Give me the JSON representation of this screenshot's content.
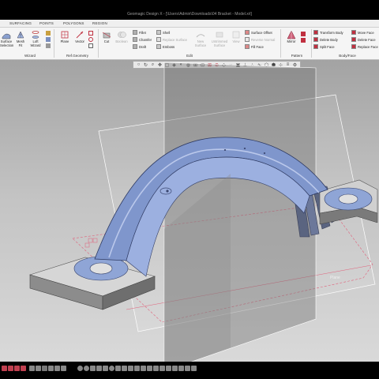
{
  "window": {
    "title": "Geomagic Design X - [\\Users\\Admin\\Downloads\\04 Bracket - Model.xrl]"
  },
  "tabs": [
    "SURFACING",
    "POINTS",
    "POLYGONS",
    "REGION"
  ],
  "ribbon": {
    "groups": {
      "wizard": "Wizard",
      "ref_geometry": "Ref.Geometry",
      "edit": "Edit",
      "pattern": "Pattern",
      "body_face": "Body/Face"
    },
    "wizard_tools": {
      "surface_partial": "Surface",
      "surface_partial2": "Selection",
      "mesh_fit": "Mesh\nFit",
      "loft_wizard": "Loft\nWizard"
    },
    "ref_tools": {
      "plane": "Plane",
      "vector": "Vector"
    },
    "edit_tools": {
      "cut": "Cut",
      "boolean": "Boolean",
      "fillet": "Fillet",
      "chamfer": "Chamfer",
      "draft": "Draft",
      "shell": "Shell",
      "emboss": "Emboss",
      "replace_surface": "Replace Surface",
      "new_surface": "New\nSurface",
      "untrimmed": "Untrimmed\nSurface",
      "view": "View",
      "surface_offset": "Surface Offset",
      "reverse_normal": "Reverse Normal",
      "fill_face": "Fill Face"
    },
    "pattern_tools": {
      "mirror": "Mirror"
    },
    "body_face_tools": {
      "transform_body": "Transform Body",
      "delete_body": "Delete Body",
      "split_face": "Split Face",
      "move_face": "Move Face",
      "delete_face": "Delete Face",
      "replace_face": "Replace Face"
    }
  },
  "viewport": {
    "plane_label": "Plane"
  },
  "colors": {
    "part_blue": "#8fa5d6",
    "part_gray": "#a9a9a9",
    "plane_gray": "#8c8c8c",
    "sketch_red": "#e0607a"
  },
  "icons": [
    "select-icon",
    "rotate-icon",
    "zoom-icon",
    "pan-icon",
    "fit-icon",
    "view-cube-icon",
    "display-mode-icon"
  ]
}
